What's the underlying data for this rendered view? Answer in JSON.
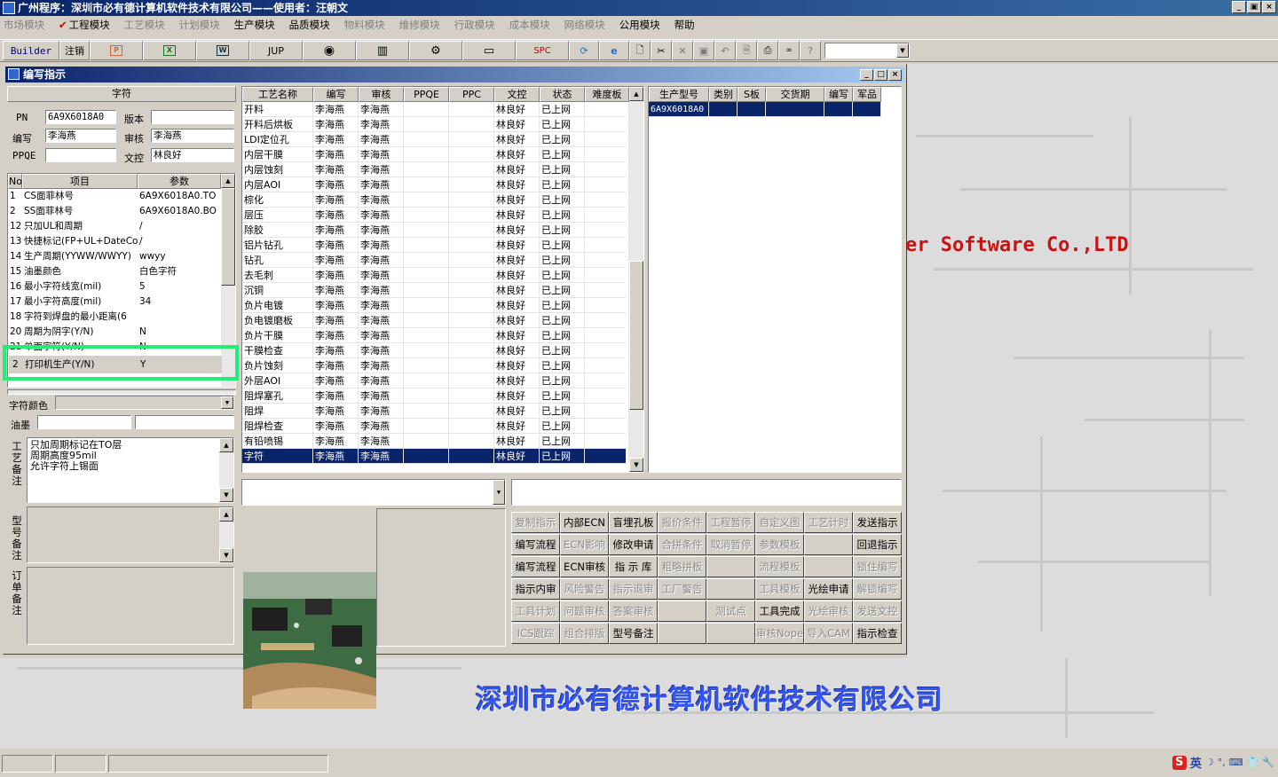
{
  "window": {
    "title": "广州程序：深圳市必有德计算机软件技术有限公司——使用者：汪朝文",
    "controls": [
      "_",
      "▣",
      "×"
    ]
  },
  "menu": [
    {
      "label": "市场模块",
      "enabled": false
    },
    {
      "label": "工程模块",
      "enabled": true,
      "checked": true
    },
    {
      "label": "工艺模块",
      "enabled": false
    },
    {
      "label": "计划模块",
      "enabled": false
    },
    {
      "label": "生产模块",
      "enabled": true
    },
    {
      "label": "品质模块",
      "enabled": true
    },
    {
      "label": "物料模块",
      "enabled": false
    },
    {
      "label": "维修模块",
      "enabled": false
    },
    {
      "label": "行政模块",
      "enabled": false
    },
    {
      "label": "成本模块",
      "enabled": false
    },
    {
      "label": "网络模块",
      "enabled": false
    },
    {
      "label": "公用模块",
      "enabled": true
    },
    {
      "label": "帮助",
      "enabled": true
    }
  ],
  "toolbar": {
    "builder": "Builder",
    "logout": "注销",
    "jup": "JUP",
    "spc": "SPC"
  },
  "child": {
    "title": "编写指示",
    "controls": [
      "_",
      "□",
      "×"
    ]
  },
  "form": {
    "section_title": "字符",
    "pn_label": "PN",
    "pn_value": "6A9X6018A0",
    "version_label": "版本",
    "version_value": "",
    "author_label": "编写",
    "author_value": "李海燕",
    "review_label": "审核",
    "review_value": "李海燕",
    "ppqe_label": "PPQE",
    "ppqe_value": "",
    "doc_label": "文控",
    "doc_value": "林良好"
  },
  "params": {
    "headers": [
      "No",
      "项目",
      "参数"
    ],
    "rows": [
      {
        "no": "1",
        "item": "CS面菲林号",
        "value": "6A9X6018A0.TO"
      },
      {
        "no": "2",
        "item": "SS面菲林号",
        "value": "6A9X6018A0.BO"
      },
      {
        "no": "12",
        "item": "只加UL和周期",
        "value": "/"
      },
      {
        "no": "13",
        "item": "快捷标记(FP+UL+DateCo",
        "value": "/"
      },
      {
        "no": "14",
        "item": "生产周期(YYWW/WWYY)",
        "value": "wwyy"
      },
      {
        "no": "15",
        "item": "油墨颜色",
        "value": "白色字符"
      },
      {
        "no": "16",
        "item": "最小字符线宽(mil)",
        "value": "5"
      },
      {
        "no": "17",
        "item": "最小字符高度(mil)",
        "value": "34"
      },
      {
        "no": "18",
        "item": "字符到焊盘的最小距离(6",
        "value": ""
      },
      {
        "no": "20",
        "item": "周期为阴字(Y/N)",
        "value": "N"
      },
      {
        "no": "21",
        "item": "单面字符(Y/N)",
        "value": "N"
      }
    ],
    "highlighted": {
      "no": "2",
      "item": "打印机生产(Y/N)",
      "value": "Y"
    }
  },
  "color_label": "字符颜色",
  "ink_label": "油墨",
  "notes": {
    "process_label": "工艺备注",
    "process_lines": [
      "只加周期标记在TO层",
      "周期高度95mil",
      "允许字符上锡面"
    ],
    "model_label": "型号备注",
    "order_label": "订单备注"
  },
  "process_table": {
    "headers": [
      "工艺名称",
      "编写",
      "审核",
      "PPQE",
      "PPC",
      "文控",
      "状态",
      "难度板"
    ],
    "rows": [
      [
        "开料",
        "李海燕",
        "李海燕",
        "",
        "",
        "林良好",
        "已上网",
        ""
      ],
      [
        "开料后烘板",
        "李海燕",
        "李海燕",
        "",
        "",
        "林良好",
        "已上网",
        ""
      ],
      [
        "LDI定位孔",
        "李海燕",
        "李海燕",
        "",
        "",
        "林良好",
        "已上网",
        ""
      ],
      [
        "内层干膜",
        "李海燕",
        "李海燕",
        "",
        "",
        "林良好",
        "已上网",
        ""
      ],
      [
        "内层蚀刻",
        "李海燕",
        "李海燕",
        "",
        "",
        "林良好",
        "已上网",
        ""
      ],
      [
        "内层AOI",
        "李海燕",
        "李海燕",
        "",
        "",
        "林良好",
        "已上网",
        ""
      ],
      [
        "棕化",
        "李海燕",
        "李海燕",
        "",
        "",
        "林良好",
        "已上网",
        ""
      ],
      [
        "层压",
        "李海燕",
        "李海燕",
        "",
        "",
        "林良好",
        "已上网",
        ""
      ],
      [
        "除胶",
        "李海燕",
        "李海燕",
        "",
        "",
        "林良好",
        "已上网",
        ""
      ],
      [
        "铝片钻孔",
        "李海燕",
        "李海燕",
        "",
        "",
        "林良好",
        "已上网",
        ""
      ],
      [
        "钻孔",
        "李海燕",
        "李海燕",
        "",
        "",
        "林良好",
        "已上网",
        ""
      ],
      [
        "去毛刺",
        "李海燕",
        "李海燕",
        "",
        "",
        "林良好",
        "已上网",
        ""
      ],
      [
        "沉铜",
        "李海燕",
        "李海燕",
        "",
        "",
        "林良好",
        "已上网",
        ""
      ],
      [
        "负片电镀",
        "李海燕",
        "李海燕",
        "",
        "",
        "林良好",
        "已上网",
        ""
      ],
      [
        "负电镀磨板",
        "李海燕",
        "李海燕",
        "",
        "",
        "林良好",
        "已上网",
        ""
      ],
      [
        "负片干膜",
        "李海燕",
        "李海燕",
        "",
        "",
        "林良好",
        "已上网",
        ""
      ],
      [
        "干膜检查",
        "李海燕",
        "李海燕",
        "",
        "",
        "林良好",
        "已上网",
        ""
      ],
      [
        "负片蚀刻",
        "李海燕",
        "李海燕",
        "",
        "",
        "林良好",
        "已上网",
        ""
      ],
      [
        "外层AOI",
        "李海燕",
        "李海燕",
        "",
        "",
        "林良好",
        "已上网",
        ""
      ],
      [
        "阻焊塞孔",
        "李海燕",
        "李海燕",
        "",
        "",
        "林良好",
        "已上网",
        ""
      ],
      [
        "阻焊",
        "李海燕",
        "李海燕",
        "",
        "",
        "林良好",
        "已上网",
        ""
      ],
      [
        "阻焊检查",
        "李海燕",
        "李海燕",
        "",
        "",
        "林良好",
        "已上网",
        ""
      ],
      [
        "有铅喷锡",
        "李海燕",
        "李海燕",
        "",
        "",
        "林良好",
        "已上网",
        ""
      ],
      [
        "字符",
        "李海燕",
        "李海燕",
        "",
        "",
        "林良好",
        "已上网",
        ""
      ]
    ],
    "selected_index": 23
  },
  "model_table": {
    "headers": [
      "生产型号",
      "类别",
      "S板",
      "交货期",
      "编写",
      "军品"
    ],
    "rows": [
      [
        "6A9X6018A0",
        "",
        "",
        "",
        "",
        ""
      ]
    ]
  },
  "actions": [
    [
      {
        "label": "复制指示",
        "enabled": false
      },
      {
        "label": "内部ECN",
        "enabled": true
      },
      {
        "label": "盲埋孔板",
        "enabled": true
      },
      {
        "label": "报价条件",
        "enabled": false
      },
      {
        "label": "工程暂停",
        "enabled": false
      },
      {
        "label": "自定义图",
        "enabled": false
      },
      {
        "label": "工艺计时",
        "enabled": false
      },
      {
        "label": "发送指示",
        "enabled": true
      }
    ],
    [
      {
        "label": "编写流程",
        "enabled": true
      },
      {
        "label": "ECN影响",
        "enabled": false
      },
      {
        "label": "修改申请",
        "enabled": true
      },
      {
        "label": "合拼条件",
        "enabled": false
      },
      {
        "label": "取消暂停",
        "enabled": false
      },
      {
        "label": "参数模板",
        "enabled": false
      },
      {
        "label": "",
        "enabled": false
      },
      {
        "label": "回退指示",
        "enabled": true
      }
    ],
    [
      {
        "label": "编写流程",
        "enabled": true
      },
      {
        "label": "ECN审核",
        "enabled": true
      },
      {
        "label": "指 示 库",
        "enabled": true
      },
      {
        "label": "粗略拼板",
        "enabled": false
      },
      {
        "label": "",
        "enabled": false
      },
      {
        "label": "流程模板",
        "enabled": false
      },
      {
        "label": "",
        "enabled": false
      },
      {
        "label": "锁住编写",
        "enabled": false
      }
    ],
    [
      {
        "label": "指示内审",
        "enabled": true
      },
      {
        "label": "风险警告",
        "enabled": false
      },
      {
        "label": "指示退审",
        "enabled": false
      },
      {
        "label": "工厂警告",
        "enabled": false
      },
      {
        "label": "",
        "enabled": false
      },
      {
        "label": "工具模板",
        "enabled": false
      },
      {
        "label": "光绘申请",
        "enabled": true
      },
      {
        "label": "解锁编写",
        "enabled": false
      }
    ],
    [
      {
        "label": "工具计划",
        "enabled": false
      },
      {
        "label": "问题审核",
        "enabled": false
      },
      {
        "label": "答案审核",
        "enabled": false
      },
      {
        "label": "",
        "enabled": false
      },
      {
        "label": "测试点",
        "enabled": false
      },
      {
        "label": "工具完成",
        "enabled": true
      },
      {
        "label": "光绘审核",
        "enabled": false
      },
      {
        "label": "发送文控",
        "enabled": false
      }
    ],
    [
      {
        "label": "ICS跟踪",
        "enabled": false
      },
      {
        "label": "组合排版",
        "enabled": false
      },
      {
        "label": "型号备注",
        "enabled": true
      },
      {
        "label": "",
        "enabled": false
      },
      {
        "label": "",
        "enabled": false
      },
      {
        "label": "审核Nope",
        "enabled": false
      },
      {
        "label": "导入CAM",
        "enabled": false
      },
      {
        "label": "指示检查",
        "enabled": true
      }
    ]
  ],
  "branding": {
    "english": "er Software Co.,LTD",
    "chinese": "深圳市必有德计算机软件技术有限公司"
  },
  "tray": {
    "ime": "S",
    "lang": "英",
    "icons": [
      "☽",
      "°,",
      "⌨",
      "👕",
      "🔧"
    ]
  },
  "colors": {
    "title_bar": "#0a246a",
    "selection": "#0a246a",
    "highlight_box": "#22ee77",
    "brand_en": "#cc1111",
    "brand_cn": "#3355ee"
  }
}
